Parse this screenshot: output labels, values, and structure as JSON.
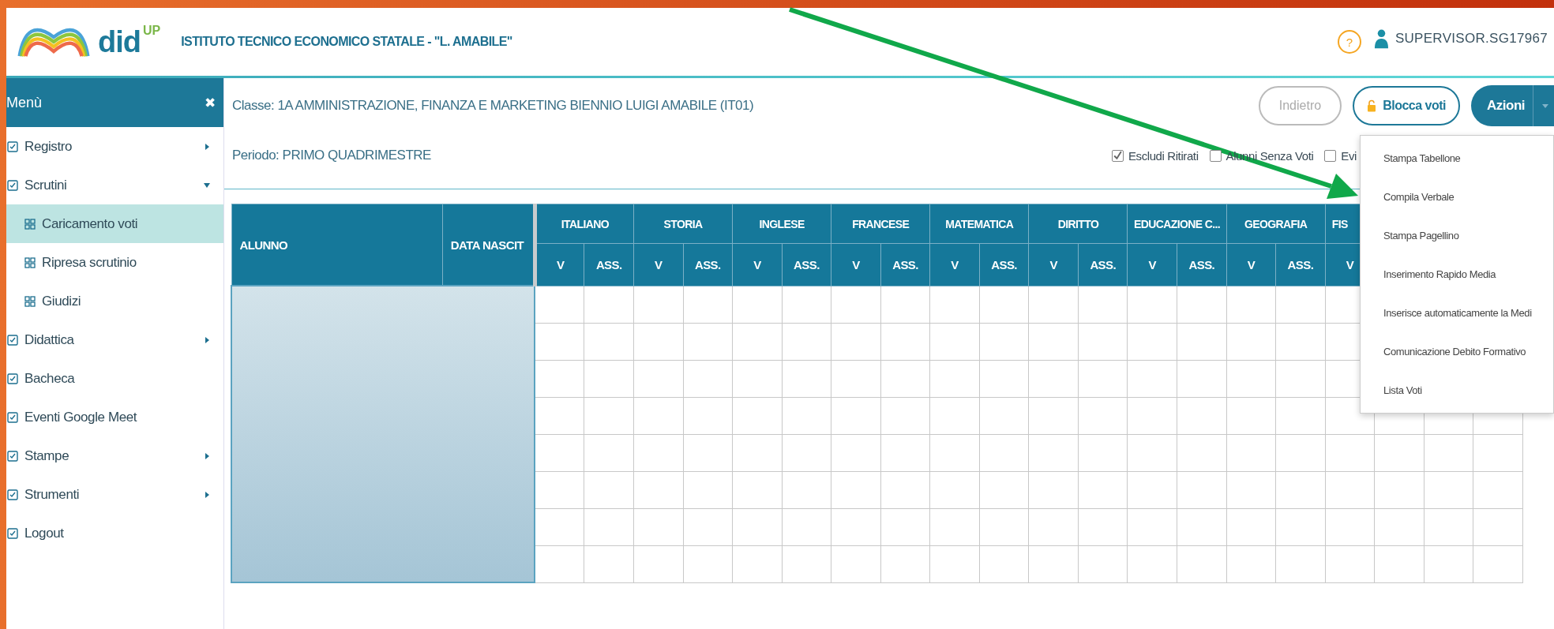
{
  "header": {
    "brand": {
      "name": "did",
      "sup": "UP"
    },
    "school": "ISTITUTO TECNICO ECONOMICO STATALE - \"L. AMABILE\"",
    "help": "?",
    "user": "SUPERVISOR.SG17967"
  },
  "sidebar": {
    "title": "Menù",
    "close": "✖",
    "items": [
      {
        "label": "Registro",
        "kind": "submenu",
        "expanded": false
      },
      {
        "label": "Scrutini",
        "kind": "submenu",
        "expanded": true,
        "children": [
          {
            "label": "Caricamento voti",
            "selected": true
          },
          {
            "label": "Ripresa scrutinio",
            "selected": false
          },
          {
            "label": "Giudizi",
            "selected": false
          }
        ]
      },
      {
        "label": "Didattica",
        "kind": "submenu",
        "expanded": false
      },
      {
        "label": "Bacheca",
        "kind": "link"
      },
      {
        "label": "Eventi Google Meet",
        "kind": "link"
      },
      {
        "label": "Stampe",
        "kind": "submenu",
        "expanded": false
      },
      {
        "label": "Strumenti",
        "kind": "submenu",
        "expanded": false
      },
      {
        "label": "Logout",
        "kind": "link"
      }
    ]
  },
  "classe": "Classe: 1A AMMINISTRAZIONE, FINANZA E MARKETING BIENNIO LUIGI AMABILE (IT01)",
  "periodo": "Periodo: PRIMO QUADRIMESTRE",
  "buttons": {
    "back": {
      "label": "Indietro",
      "disabled": true
    },
    "lock": {
      "label": "Blocca voti"
    },
    "actions": {
      "label": "Azioni",
      "expanded": true
    }
  },
  "filters": [
    {
      "label": "Escludi Ritirati",
      "checked": true
    },
    {
      "label": "Alunni Senza Voti",
      "checked": false
    },
    {
      "label": "Evi",
      "checked": false
    }
  ],
  "actions_menu": [
    "Stampa Tabellone",
    "Compila Verbale",
    "Stampa Pagellino",
    "Inserimento Rapido Media",
    "Inserisce automaticamente la Medi",
    "Comunicazione Debito Formativo",
    "Lista Voti"
  ],
  "table": {
    "columns": [
      "ALUNNO",
      "DATA NASCIT"
    ],
    "subjects": [
      {
        "name": "ITALIANO",
        "sub_columns": [
          "V",
          "ASS."
        ]
      },
      {
        "name": "STORIA",
        "sub_columns": [
          "V",
          "ASS."
        ]
      },
      {
        "name": "INGLESE",
        "sub_columns": [
          "V",
          "ASS."
        ]
      },
      {
        "name": "FRANCESE",
        "sub_columns": [
          "V",
          "ASS."
        ]
      },
      {
        "name": "MATEMATICA",
        "sub_columns": [
          "V",
          "ASS."
        ]
      },
      {
        "name": "DIRITTO",
        "sub_columns": [
          "V",
          "ASS."
        ]
      },
      {
        "name": "EDUCAZIONE C...",
        "sub_columns": [
          "V",
          "ASS."
        ]
      },
      {
        "name": "GEOGRAFIA",
        "sub_columns": [
          "V",
          "ASS."
        ]
      },
      {
        "name": "FIS",
        "sub_columns": [
          "V"
        ]
      }
    ]
  }
}
